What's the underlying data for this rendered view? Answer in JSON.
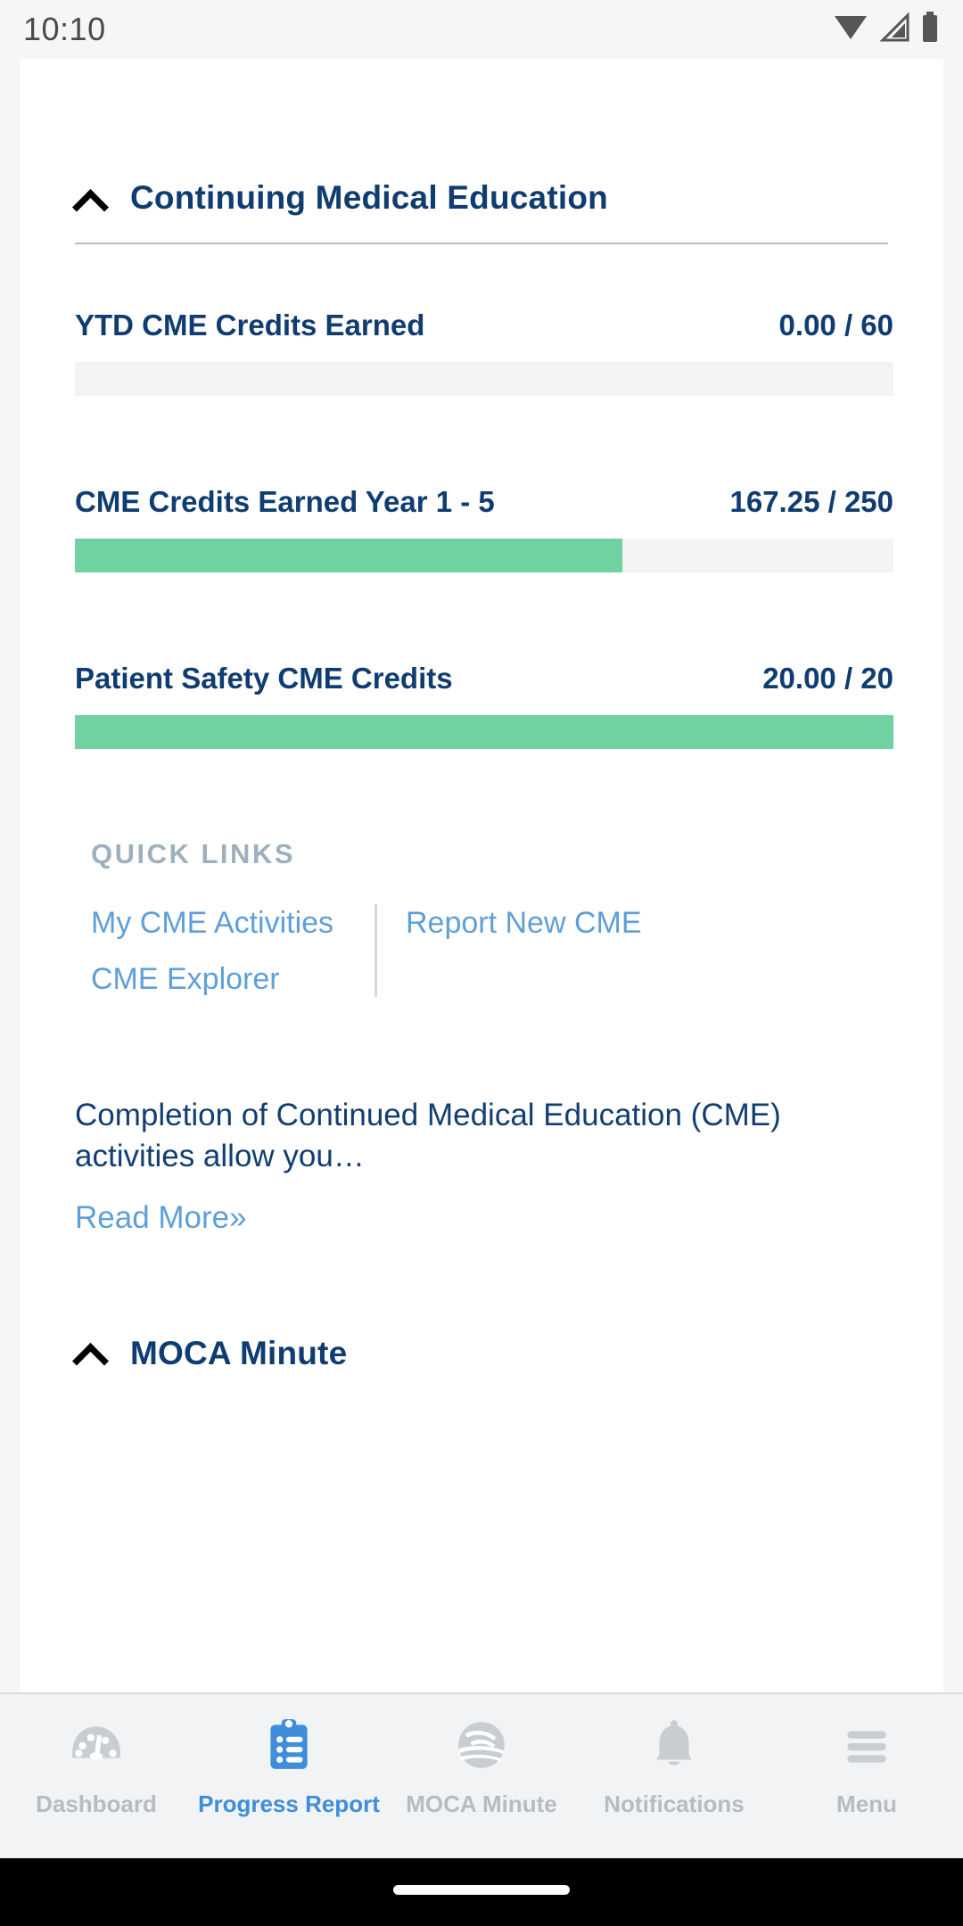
{
  "status_bar": {
    "time": "10:10",
    "icons": [
      "wifi-icon",
      "cellular-icon",
      "battery-icon"
    ]
  },
  "colors": {
    "navy": "#0f3c71",
    "link_blue": "#5f9fd8",
    "accent_blue": "#3f8ddb",
    "progress_green": "#6fd2a0",
    "track_gray": "#f1f3f4",
    "muted_gray": "#b6bcc0",
    "quick_links_gray": "#9fb0bd"
  },
  "sections": {
    "cme": {
      "title": "Continuing Medical Education",
      "expanded": true,
      "chevron": "chevron-up-icon",
      "progress_items": [
        {
          "label": "YTD CME Credits Earned",
          "value_text": "0.00 / 60",
          "earned": 0.0,
          "target": 60,
          "percent": 0
        },
        {
          "label": "CME Credits Earned Year 1 - 5",
          "value_text": "167.25 / 250",
          "earned": 167.25,
          "target": 250,
          "percent": 66.9
        },
        {
          "label": "Patient Safety CME Credits",
          "value_text": "20.00 / 20",
          "earned": 20.0,
          "target": 20,
          "percent": 100
        }
      ],
      "quick_links": {
        "heading": "QUICK LINKS",
        "left": [
          {
            "label": "My CME Activities"
          },
          {
            "label": "CME Explorer"
          }
        ],
        "right": [
          {
            "label": "Report New CME"
          }
        ]
      },
      "description": {
        "text": "Completion of Continued Medical Education (CME) activities allow you…",
        "read_more_label": "Read More»"
      }
    },
    "moca": {
      "title": "MOCA Minute",
      "expanded": true,
      "chevron": "chevron-up-icon"
    }
  },
  "bottom_nav": {
    "items": [
      {
        "label": "Dashboard",
        "icon": "gauge-icon",
        "active": false
      },
      {
        "label": "Progress Report",
        "icon": "clipboard-list-icon",
        "active": true
      },
      {
        "label": "MOCA Minute",
        "icon": "swirl-logo-icon",
        "active": false
      },
      {
        "label": "Notifications",
        "icon": "bell-icon",
        "active": false
      },
      {
        "label": "Menu",
        "icon": "hamburger-icon",
        "active": false
      }
    ]
  }
}
